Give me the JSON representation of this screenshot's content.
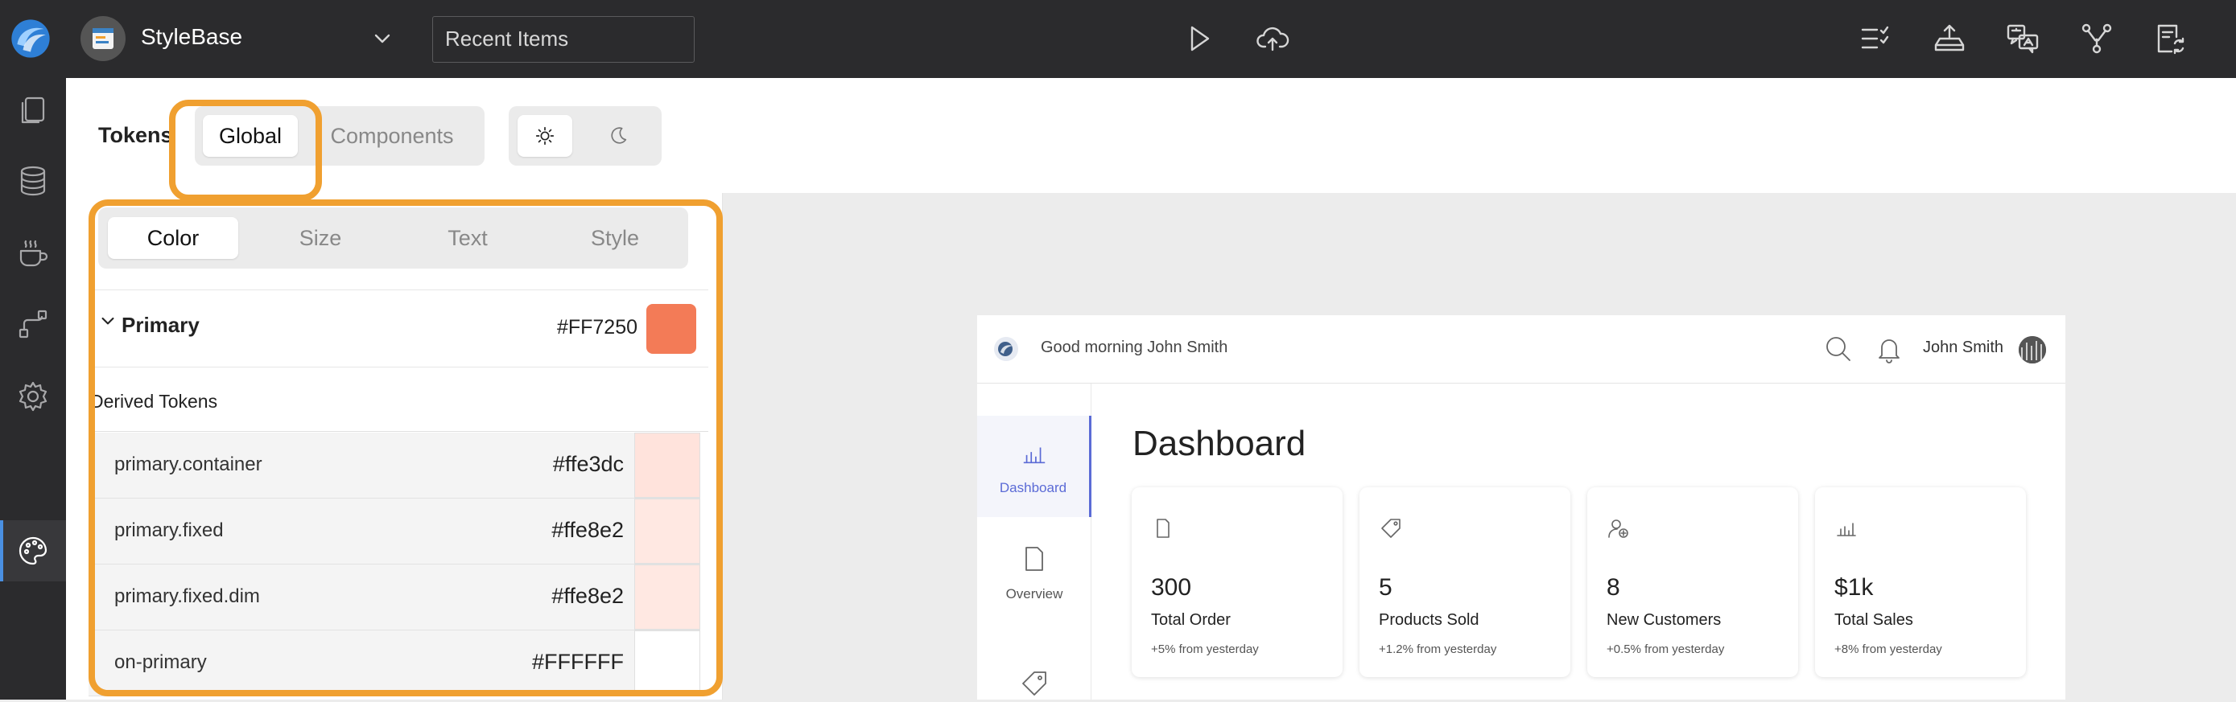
{
  "topbar": {
    "app_name": "StyleBase",
    "recent_placeholder": "Recent Items",
    "icons": [
      "app-logo-icon",
      "project-icon",
      "chevron-down-icon",
      "play-icon",
      "cloud-upload-icon",
      "checklist-icon",
      "upload-tray-icon",
      "translate-icon",
      "share-nodes-icon",
      "document-sync-icon"
    ]
  },
  "rail": {
    "icons": [
      "pages-icon",
      "database-icon",
      "coffee-icon",
      "workflow-icon",
      "settings-icon",
      "palette-icon"
    ],
    "active": "palette-icon"
  },
  "header": {
    "tokens_label": "Tokens",
    "scope_tabs": [
      "Global",
      "Components"
    ],
    "active_scope": "Global",
    "theme_modes": [
      "sun-icon",
      "moon-icon"
    ]
  },
  "panel": {
    "category_tabs": [
      "Color",
      "Size",
      "Text",
      "Style"
    ],
    "active_category": "Color",
    "primary": {
      "label": "Primary",
      "value": "#FF7250",
      "color": "#f37b57"
    },
    "derived_title": "Derived Tokens",
    "tokens": [
      {
        "name": "primary.container",
        "value": "#ffe3dc",
        "color": "#ffe3dc"
      },
      {
        "name": "primary.fixed",
        "value": "#ffe8e2",
        "color": "#ffe8e2"
      },
      {
        "name": "primary.fixed.dim",
        "value": "#ffe8e2",
        "color": "#ffe8e2"
      },
      {
        "name": "on-primary",
        "value": "#FFFFFF",
        "color": "#ffffff"
      }
    ]
  },
  "preview": {
    "greeting": "Good morning John Smith",
    "user_name": "John Smith",
    "page_title": "Dashboard",
    "nav": [
      {
        "label": "Dashboard",
        "active": true
      },
      {
        "label": "Overview",
        "active": false
      }
    ],
    "cards": [
      {
        "icon": "document-icon",
        "value": "300",
        "label": "Total Order",
        "sub": "+5% from yesterday"
      },
      {
        "icon": "tag-icon",
        "value": "5",
        "label": "Products Sold",
        "sub": "+1.2% from yesterday"
      },
      {
        "icon": "add-user-icon",
        "value": "8",
        "label": "New Customers",
        "sub": "+0.5% from yesterday"
      },
      {
        "icon": "bar-chart-icon",
        "value": "$1k",
        "label": "Total Sales",
        "sub": "+8% from yesterday"
      }
    ]
  },
  "colors": {
    "accent": "#f0a030",
    "rail_active": "#4a90e2",
    "nav_active": "#5b6bd6"
  }
}
